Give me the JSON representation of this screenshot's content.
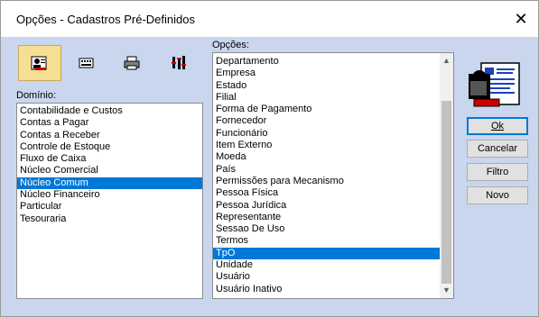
{
  "window": {
    "title": "Opções - Cadastros Pré-Definidos",
    "close": "✕"
  },
  "labels": {
    "dominio": "Domínio:",
    "opcoes": "Opções:"
  },
  "toolbar": [
    {
      "icon": "user-card-icon",
      "active": true
    },
    {
      "icon": "keyboard-icon",
      "active": false
    },
    {
      "icon": "printer-icon",
      "active": false
    },
    {
      "icon": "tools-icon",
      "active": false
    }
  ],
  "dominio_items": [
    "Contabilidade e Custos",
    "Contas a Pagar",
    "Contas a Receber",
    "Controle de Estoque",
    "Fluxo de Caixa",
    "Núcleo Comercial",
    "Núcleo Comum",
    "Núcleo Financeiro",
    "Particular",
    "Tesouraria"
  ],
  "dominio_selected": "Núcleo Comum",
  "opcoes_items": [
    "Departamento",
    "Empresa",
    "Estado",
    "Filial",
    "Forma de Pagamento",
    "Fornecedor",
    "Funcionário",
    "Item Externo",
    "Moeda",
    "País",
    "Permissões para Mecanismo",
    "Pessoa Física",
    "Pessoa Jurídica",
    "Representante",
    "Sessao De Uso",
    "Termos",
    "TpO",
    "Unidade",
    "Usuário",
    "Usuário Inativo"
  ],
  "opcoes_selected": "TpO",
  "buttons": {
    "ok": "Ok",
    "cancelar": "Cancelar",
    "filtro": "Filtro",
    "novo": "Novo"
  },
  "colors": {
    "selection": "#0078d7",
    "background": "#c9d6ee",
    "toolbar_active": "#f6df92"
  }
}
